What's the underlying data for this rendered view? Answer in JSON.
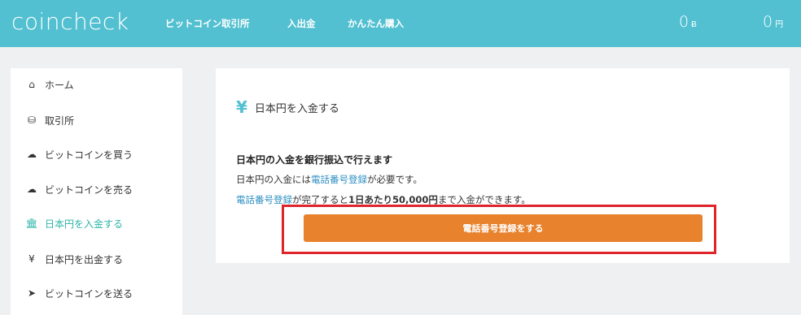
{
  "header": {
    "logo": "coincheck",
    "nav": [
      "ビットコイン取引所",
      "入出金",
      "かんたん購入"
    ],
    "balance_btc": "0",
    "balance_btc_unit": "Ƀ",
    "balance_jpy": "0",
    "balance_jpy_unit": "円"
  },
  "sidebar": {
    "items": [
      {
        "label": "ホーム",
        "icon": "home-icon",
        "glyph": "⌂"
      },
      {
        "label": "取引所",
        "icon": "coins-icon",
        "glyph": "⛁"
      },
      {
        "label": "ビットコインを買う",
        "icon": "cloud-download-icon",
        "glyph": "☁"
      },
      {
        "label": "ビットコインを売る",
        "icon": "cloud-upload-icon",
        "glyph": "☁"
      },
      {
        "label": "日本円を入金する",
        "icon": "bank-icon",
        "glyph": "🏛"
      },
      {
        "label": "日本円を出金する",
        "icon": "yen-icon",
        "glyph": "¥"
      },
      {
        "label": "ビットコインを送る",
        "icon": "send-icon",
        "glyph": "➤"
      }
    ],
    "active_index": 4
  },
  "card": {
    "title_icon": "¥",
    "title": "日本円を入金する",
    "heading": "日本円の入金を銀行振込で行えます",
    "line1_prefix": "日本円の入金には",
    "line1_link": "電話番号登録",
    "line1_suffix": "が必要です。",
    "line2_link": "電話番号登録",
    "line2_mid": "が完了すると",
    "line2_bold": "1日あたり50,000円",
    "line2_suffix": "まで入金ができます。",
    "button_label": "電話番号登録をする"
  },
  "colors": {
    "topbar": "#52c0d1",
    "accent_active": "#2eb5a8",
    "button": "#e8822c",
    "highlight": "#e0242c",
    "link": "#2d8fc3"
  }
}
